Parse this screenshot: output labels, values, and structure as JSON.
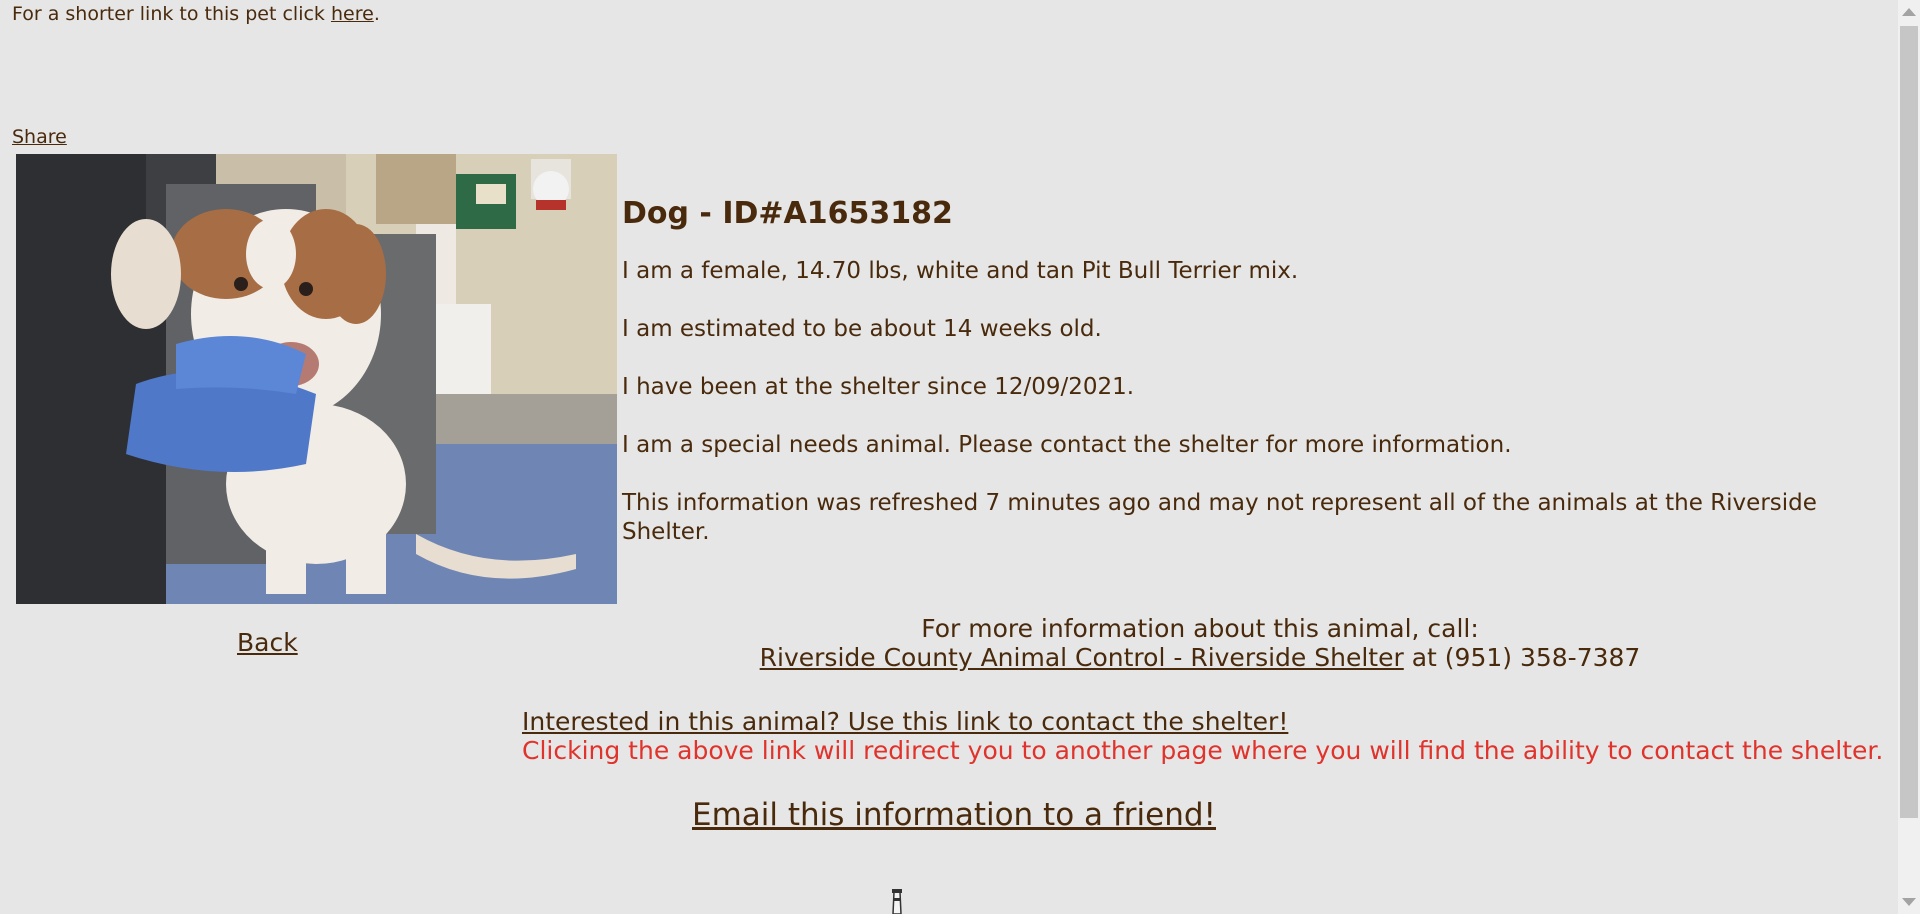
{
  "top_bar": {
    "short_link_prefix": "For a shorter link to this pet click ",
    "short_link_text": "here",
    "short_link_suffix": "."
  },
  "share": {
    "label": "Share"
  },
  "photo": {
    "alt": "Photo of puppy held by person in blue gloves"
  },
  "animal": {
    "title": "Dog - ID#A1653182",
    "lines": [
      "I am a female, 14.70 lbs, white and tan Pit Bull Terrier mix.",
      "I am estimated to be about 14 weeks old.",
      "I have been at the shelter since 12/09/2021.",
      "I am a special needs animal. Please contact the shelter for more information.",
      "This information was refreshed 7 minutes ago and may not represent all of the animals at the Riverside Shelter."
    ]
  },
  "nav": {
    "back_label": "Back"
  },
  "contact": {
    "call_prompt": "For more information about this animal, call:",
    "shelter_link": "Riverside County Animal Control - Riverside Shelter",
    "phone_text": " at (951) 358-7387",
    "interested_link": "Interested in this animal? Use this link to contact the shelter!",
    "redirect_note": "Clicking the above link will redirect you to another page where you will find the ability to contact the shelter.",
    "email_link": "Email this information to a friend!"
  },
  "colors": {
    "background": "#e6e6e6",
    "text": "#4a2a0c",
    "warning": "#e0332c"
  }
}
